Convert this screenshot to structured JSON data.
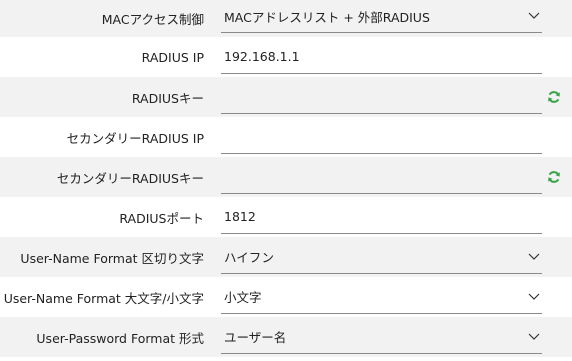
{
  "fields": [
    {
      "label": "MACアクセス制御",
      "value": "MACアドレスリスト + 外部RADIUS",
      "type": "select"
    },
    {
      "label": "RADIUS IP",
      "value": "192.168.1.1",
      "type": "text"
    },
    {
      "label": "RADIUSキー",
      "value": "",
      "type": "secret"
    },
    {
      "label": "セカンダリーRADIUS IP",
      "value": "",
      "type": "text"
    },
    {
      "label": "セカンダリーRADIUSキー",
      "value": "",
      "type": "secret"
    },
    {
      "label": "RADIUSポート",
      "value": "1812",
      "type": "text"
    },
    {
      "label": "User-Name Format 区切り文字",
      "value": "ハイフン",
      "type": "select"
    },
    {
      "label": "User-Name Format 大文字/小文字",
      "value": "小文字",
      "type": "select"
    },
    {
      "label": "User-Password Format 形式",
      "value": "ユーザー名",
      "type": "select"
    }
  ],
  "icons": {
    "select": "chevron-down-icon",
    "secret": "refresh-icon"
  },
  "colors": {
    "row_shade": "#f2f2f2",
    "underline": "#8a8a8a",
    "refresh_icon": "#3aa14a"
  }
}
